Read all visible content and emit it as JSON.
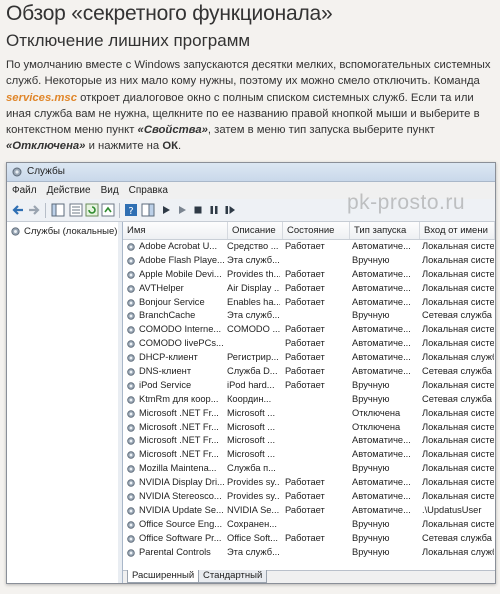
{
  "article": {
    "heading": "Обзор «секретного функционала»",
    "subheading": "Отключение лишних программ",
    "p1": "По умолчанию вместе с Windows запускаются десятки мелких, вспомогательных системных служб. Некоторые из них мало кому нужны, поэтому их можно смело отключить. Команда ",
    "cmd": "services.msc",
    "p2": " откроет диалоговое окно с полным списком системных служб. Если та или иная служба вам не нужна, щелкните по ее названию правой кнопкой мыши и выберите в контекстном меню пункт ",
    "props": "«Свойства»",
    "p3": ", затем в меню тип запуска выберите пункт ",
    "disabled": "«Отключена»",
    "p4": " и нажмите на ",
    "ok": "ОК",
    "p5": "."
  },
  "window": {
    "title": "Службы",
    "watermark": "pk-prosto.ru",
    "menu": [
      "Файл",
      "Действие",
      "Вид",
      "Справка"
    ],
    "left_item": "Службы (локальные)",
    "columns": [
      "Имя",
      "Описание",
      "Состояние",
      "Тип запуска",
      "Вход от имени"
    ],
    "rows": [
      [
        "Adobe Acrobat U...",
        "Средство ...",
        "Работает",
        "Автоматиче...",
        "Локальная систе"
      ],
      [
        "Adobe Flash Playe...",
        "Эта служб...",
        "",
        "Вручную",
        "Локальная систе"
      ],
      [
        "Apple Mobile Devi...",
        "Provides th...",
        "Работает",
        "Автоматиче...",
        "Локальная систе"
      ],
      [
        "AVTHelper",
        "Air Display ...",
        "Работает",
        "Автоматиче...",
        "Локальная систе"
      ],
      [
        "Bonjour Service",
        "Enables ha...",
        "Работает",
        "Автоматиче...",
        "Локальная систе"
      ],
      [
        "BranchCache",
        "Эта служб...",
        "",
        "Вручную",
        "Сетевая служба"
      ],
      [
        "COMODO Interne...",
        "COMODO ...",
        "Работает",
        "Автоматиче...",
        "Локальная систе"
      ],
      [
        "COMODO livePCs...",
        "",
        "Работает",
        "Автоматиче...",
        "Локальная систе"
      ],
      [
        "DHCP-клиент",
        "Регистрир...",
        "Работает",
        "Автоматиче...",
        "Локальная служб"
      ],
      [
        "DNS-клиент",
        "Служба D...",
        "Работает",
        "Автоматиче...",
        "Сетевая служба"
      ],
      [
        "iPod Service",
        "iPod hard...",
        "Работает",
        "Вручную",
        "Локальная систе"
      ],
      [
        "KtmRm для коор...",
        "Координ...",
        "",
        "Вручную",
        "Сетевая служба"
      ],
      [
        "Microsoft .NET Fr...",
        "Microsoft ...",
        "",
        "Отключена",
        "Локальная систе"
      ],
      [
        "Microsoft .NET Fr...",
        "Microsoft ...",
        "",
        "Отключена",
        "Локальная систе"
      ],
      [
        "Microsoft .NET Fr...",
        "Microsoft ...",
        "",
        "Автоматиче...",
        "Локальная систе"
      ],
      [
        "Microsoft .NET Fr...",
        "Microsoft ...",
        "",
        "Автоматиче...",
        "Локальная систе"
      ],
      [
        "Mozilla Maintena...",
        "Служба п...",
        "",
        "Вручную",
        "Локальная систе"
      ],
      [
        "NVIDIA Display Dri...",
        "Provides sy...",
        "Работает",
        "Автоматиче...",
        "Локальная систе"
      ],
      [
        "NVIDIA Stereosco...",
        "Provides sy...",
        "Работает",
        "Автоматиче...",
        "Локальная систе"
      ],
      [
        "NVIDIA Update Se...",
        "NVIDIA Se...",
        "Работает",
        "Автоматиче...",
        ".\\UpdatusUser"
      ],
      [
        "Office Source Eng...",
        "Сохранен...",
        "",
        "Вручную",
        "Локальная систе"
      ],
      [
        "Office Software Pr...",
        "Office Soft...",
        "Работает",
        "Вручную",
        "Сетевая служба"
      ],
      [
        "Parental Controls",
        "Эта служб...",
        "",
        "Вручную",
        "Локальная служб"
      ]
    ],
    "tabs": [
      "Расширенный",
      "Стандартный"
    ]
  }
}
